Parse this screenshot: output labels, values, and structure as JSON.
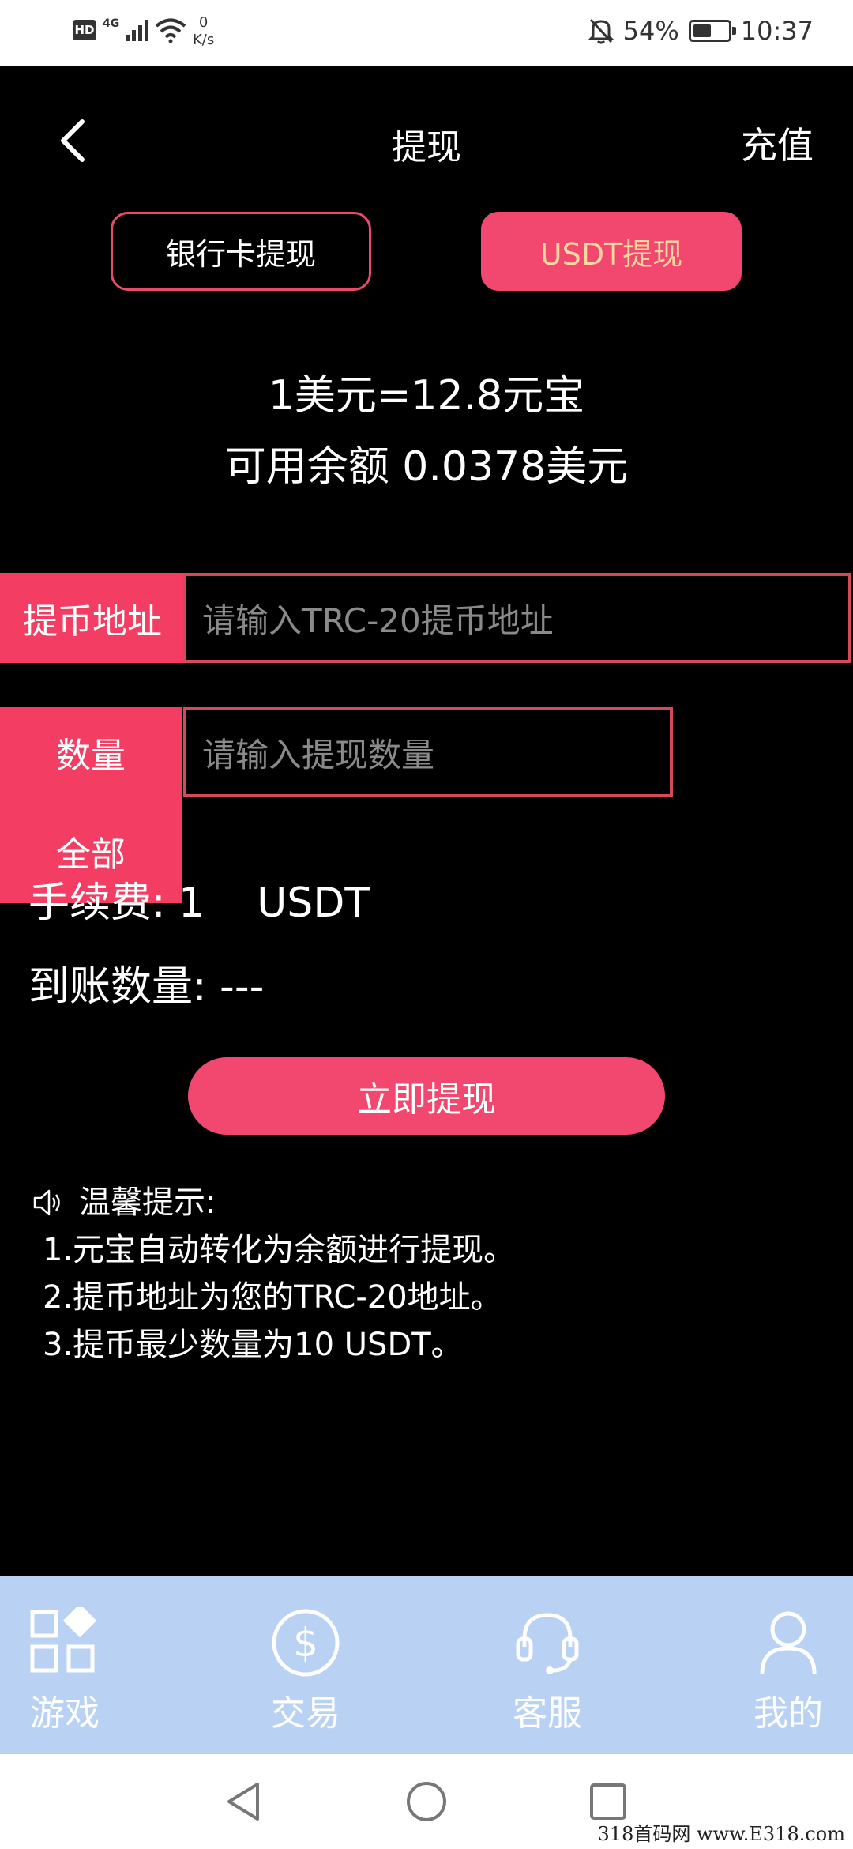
{
  "status_bar": {
    "hd": "HD",
    "network": "4G",
    "speed_value": "0",
    "speed_unit": "K/s",
    "battery_level": "54%",
    "battery_fraction": 0.54,
    "time": "10:37"
  },
  "header": {
    "title": "提现",
    "recharge_label": "充值"
  },
  "tabs": [
    {
      "label": "银行卡提现",
      "selected": false
    },
    {
      "label": "USDT提现",
      "selected": true
    }
  ],
  "rate_text": "1美元=12.8元宝",
  "balance_text": "可用余额 0.0378美元",
  "form": {
    "address_label": "提币地址",
    "address_placeholder": "请输入TRC-20提币地址",
    "quantity_label": "数量",
    "quantity_placeholder": "请输入提现数量",
    "all_label": "全部"
  },
  "fee_text": "手续费: 1    USDT",
  "arrival_text": "到账数量: ---",
  "submit_label": "立即提现",
  "tips": {
    "title": "温馨提示:",
    "lines": [
      "1.元宝自动转化为余额进行提现。",
      "2.提币地址为您的TRC-20地址。",
      "3.提币最少数量为10 USDT。"
    ]
  },
  "bottom_nav": [
    {
      "label": "游戏",
      "icon": "grid-icon"
    },
    {
      "label": "交易",
      "icon": "dollar-coin-icon"
    },
    {
      "label": "客服",
      "icon": "headset-icon"
    },
    {
      "label": "我的",
      "icon": "person-icon"
    }
  ],
  "watermark": "318首码网  www.E318.com",
  "colors": {
    "accent": "#f2486f",
    "tab_text_selected": "#ffd7a0",
    "nav_bg": "#b9d2f4"
  }
}
